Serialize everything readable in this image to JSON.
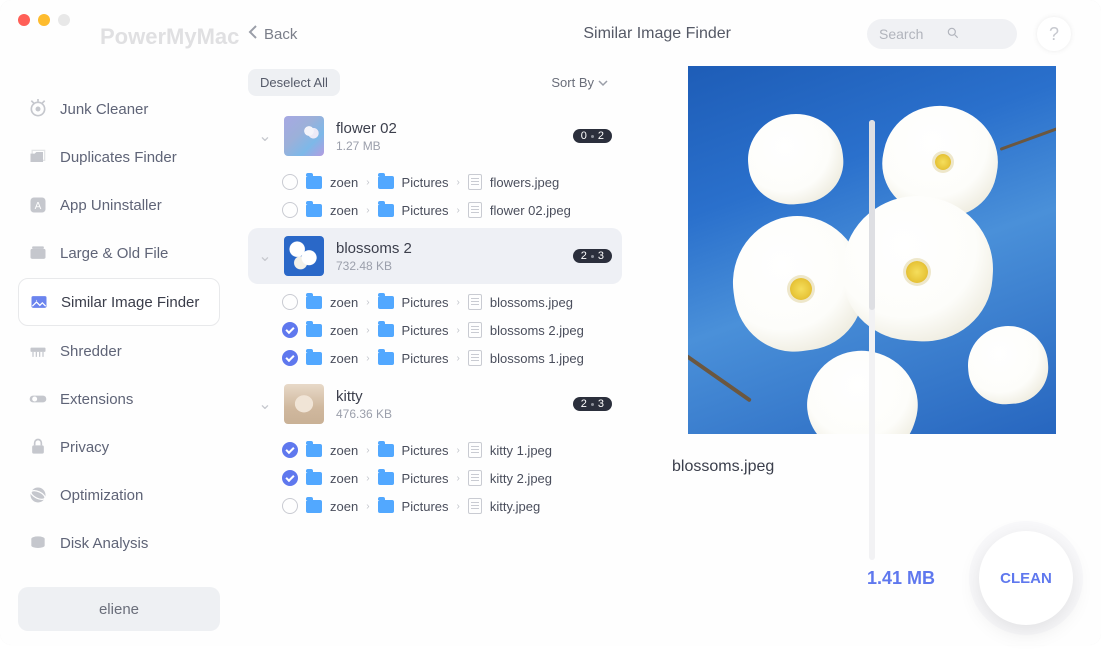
{
  "appTitle": "PowerMyMac",
  "back": "Back",
  "sectionTitle": "Similar Image Finder",
  "searchPlaceholder": "Search",
  "helpGlyph": "?",
  "deselect": "Deselect All",
  "sortBy": "Sort By",
  "user": "eliene",
  "nav": [
    {
      "label": "Junk Cleaner"
    },
    {
      "label": "Duplicates Finder"
    },
    {
      "label": "App Uninstaller"
    },
    {
      "label": "Large & Old File"
    },
    {
      "label": "Similar Image Finder"
    },
    {
      "label": "Shredder"
    },
    {
      "label": "Extensions"
    },
    {
      "label": "Privacy"
    },
    {
      "label": "Optimization"
    },
    {
      "label": "Disk Analysis"
    }
  ],
  "groups": [
    {
      "name": "flower 02",
      "size": "1.27 MB",
      "badge": {
        "a": "0",
        "b": "2"
      },
      "files": [
        {
          "checked": false,
          "dir1": "zoen",
          "dir2": "Pictures",
          "name": "flowers.jpeg"
        },
        {
          "checked": false,
          "dir1": "zoen",
          "dir2": "Pictures",
          "name": "flower 02.jpeg"
        }
      ]
    },
    {
      "name": "blossoms 2",
      "size": "732.48 KB",
      "badge": {
        "a": "2",
        "b": "3"
      },
      "files": [
        {
          "checked": false,
          "dir1": "zoen",
          "dir2": "Pictures",
          "name": "blossoms.jpeg"
        },
        {
          "checked": true,
          "dir1": "zoen",
          "dir2": "Pictures",
          "name": "blossoms 2.jpeg"
        },
        {
          "checked": true,
          "dir1": "zoen",
          "dir2": "Pictures",
          "name": "blossoms 1.jpeg"
        }
      ]
    },
    {
      "name": "kitty",
      "size": "476.36 KB",
      "badge": {
        "a": "2",
        "b": "3"
      },
      "files": [
        {
          "checked": true,
          "dir1": "zoen",
          "dir2": "Pictures",
          "name": "kitty 1.jpeg"
        },
        {
          "checked": true,
          "dir1": "zoen",
          "dir2": "Pictures",
          "name": "kitty 2.jpeg"
        },
        {
          "checked": false,
          "dir1": "zoen",
          "dir2": "Pictures",
          "name": "kitty.jpeg"
        }
      ]
    }
  ],
  "previewName": "blossoms.jpeg",
  "selectedBytes": "1.41 MB",
  "cleanLabel": "CLEAN"
}
